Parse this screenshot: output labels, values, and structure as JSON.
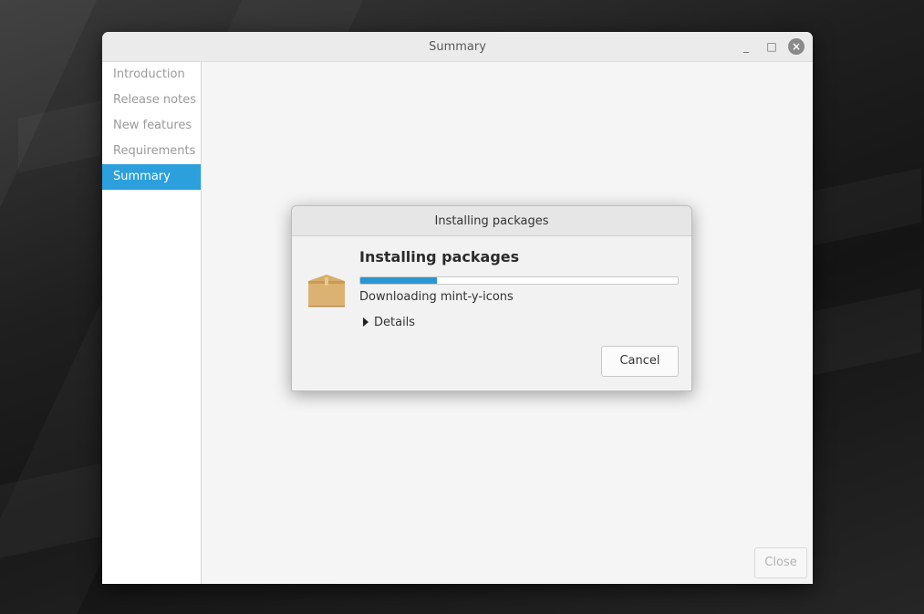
{
  "window": {
    "title": "Summary",
    "controls": {
      "minimize": "_",
      "maximize": "□",
      "close": "×"
    }
  },
  "sidebar": {
    "items": [
      {
        "label": "Introduction",
        "active": false
      },
      {
        "label": "Release notes",
        "active": false
      },
      {
        "label": "New features",
        "active": false
      },
      {
        "label": "Requirements",
        "active": false
      },
      {
        "label": "Summary",
        "active": true
      }
    ]
  },
  "footer": {
    "close_label": "Close"
  },
  "dialog": {
    "title": "Installing packages",
    "heading": "Installing packages",
    "icon": "package-box-icon",
    "progress": 0.24,
    "status": "Downloading mint-y-icons",
    "details_label": "Details",
    "cancel_label": "Cancel"
  },
  "colors": {
    "accent": "#2ba0dd",
    "progress_fill": "#2a96d4",
    "box": "#d8ad6a"
  }
}
